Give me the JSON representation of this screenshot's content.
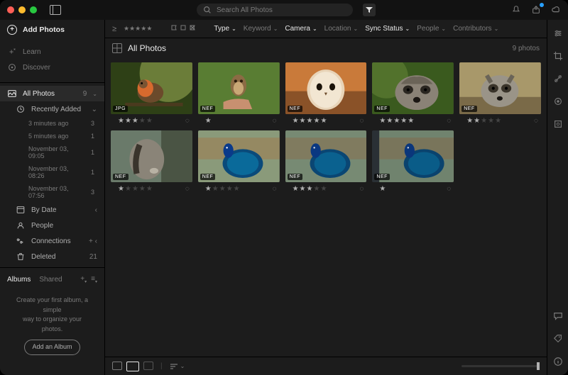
{
  "titlebar": {
    "search_placeholder": "Search All Photos"
  },
  "sidebar": {
    "add_photos": "Add Photos",
    "learn": "Learn",
    "discover": "Discover",
    "all_photos": {
      "label": "All Photos",
      "count": "9"
    },
    "recently_added": {
      "label": "Recently Added",
      "items": [
        {
          "label": "3 minutes ago",
          "count": "3"
        },
        {
          "label": "5 minutes ago",
          "count": "1"
        },
        {
          "label": "November 03, 09:05",
          "count": "1"
        },
        {
          "label": "November 03, 08:26",
          "count": "1"
        },
        {
          "label": "November 03, 07:56",
          "count": "3"
        }
      ]
    },
    "by_date": "By Date",
    "people": "People",
    "connections": "Connections",
    "deleted": {
      "label": "Deleted",
      "count": "21"
    },
    "albums_tab": "Albums",
    "shared_tab": "Shared",
    "albums_empty_1": "Create your first album, a simple",
    "albums_empty_2": "way to organize your photos.",
    "add_album_btn": "Add an Album"
  },
  "filterbar": {
    "type": "Type",
    "keyword": "Keyword",
    "camera": "Camera",
    "location": "Location",
    "sync": "Sync Status",
    "people": "People",
    "contributors": "Contributors"
  },
  "header": {
    "title": "All Photos",
    "count": "9 photos"
  },
  "photos": [
    {
      "badge": "JPG",
      "rating": 3,
      "thumb": "robin"
    },
    {
      "badge": "NEF",
      "rating": 0,
      "thumb": "owl"
    },
    {
      "badge": "NEF",
      "rating": 5,
      "thumb": "barnowl"
    },
    {
      "badge": "NEF",
      "rating": 5,
      "thumb": "raccoon1"
    },
    {
      "badge": "NEF",
      "rating": 2,
      "thumb": "raccoon2"
    },
    {
      "badge": "NEF",
      "rating": 1,
      "thumb": "raccoon3"
    },
    {
      "badge": "NEF",
      "rating": 1,
      "thumb": "peacock1"
    },
    {
      "badge": "NEF",
      "rating": 3,
      "thumb": "peacock2"
    },
    {
      "badge": "NEF",
      "rating": 0,
      "thumb": "peacock3"
    }
  ]
}
